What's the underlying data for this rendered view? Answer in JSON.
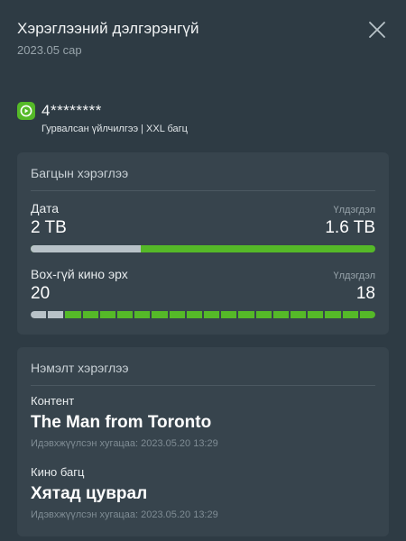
{
  "header": {
    "title": "Хэрэглээний дэлгэрэнгүй",
    "subtitle": "2023.05 сар",
    "close_icon": "close-icon"
  },
  "account": {
    "icon": "play-icon",
    "number": "4********",
    "plan": "Гурвалсан үйлчилгээ | XXL багц",
    "accent_color": "#55b928"
  },
  "package_usage": {
    "title": "Багцын хэрэглээ",
    "items": [
      {
        "label": "Дата",
        "remaining_label": "Үлдэгдэл",
        "total": "2 TB",
        "remaining": "1.6 TB",
        "used_fraction": 0.32
      },
      {
        "label": "Box-гүй кино эрх",
        "remaining_label": "Үлдэгдэл",
        "total": "20",
        "remaining": "18",
        "total_count": 20,
        "remaining_count": 18
      }
    ]
  },
  "extra_usage": {
    "title": "Нэмэлт хэрэглээ",
    "items": [
      {
        "label": "Контент",
        "value": "The Man from Toronto",
        "activated": "Идэвхжүүлсэн хугацаа: 2023.05.20 13:29"
      },
      {
        "label": "Кино багц",
        "value": "Хятад цуврал",
        "activated": "Идэвхжүүлсэн хугацаа: 2023.05.20 13:29"
      }
    ]
  }
}
